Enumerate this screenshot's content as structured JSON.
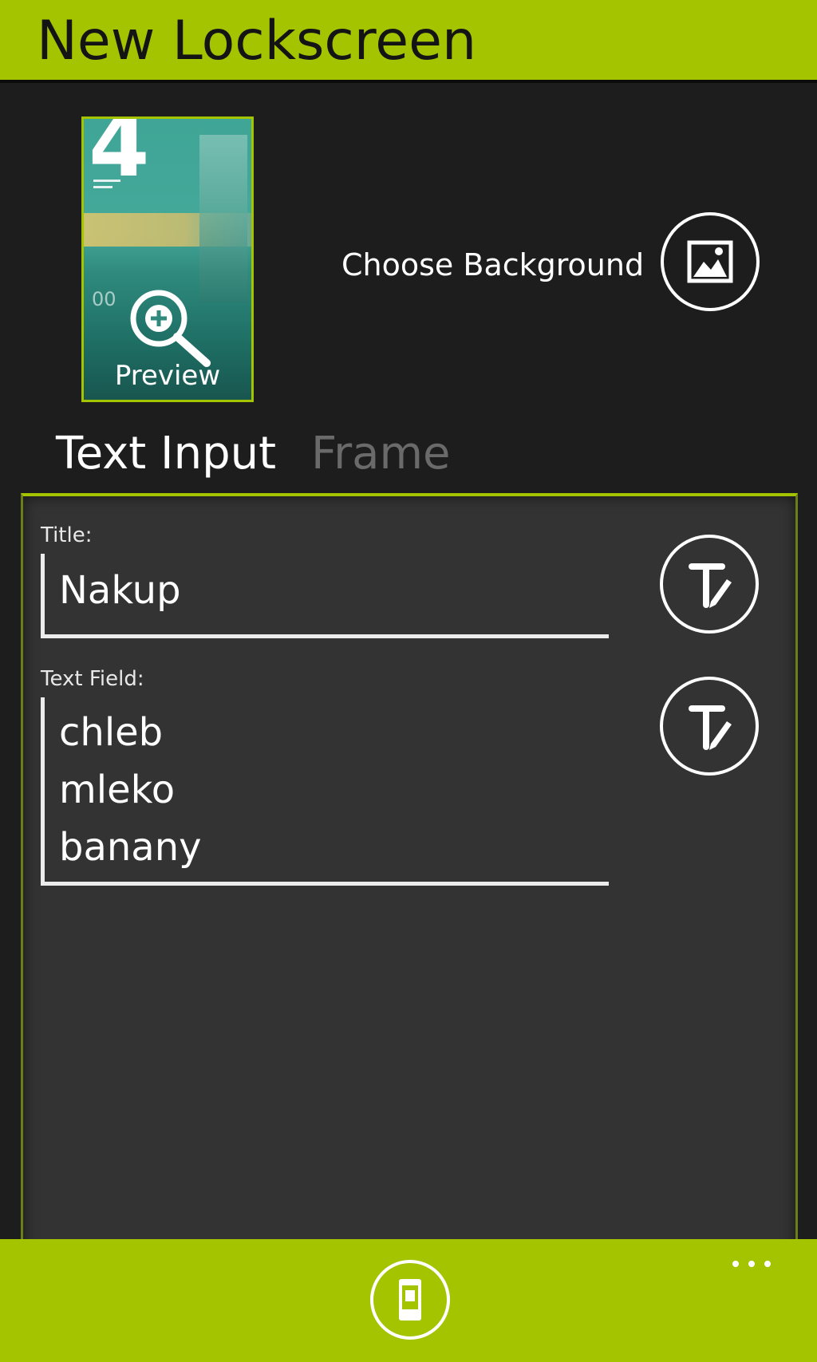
{
  "header": {
    "title": "New Lockscreen"
  },
  "preview": {
    "label": "Preview",
    "date_number": "4",
    "time_snippet": "00"
  },
  "background": {
    "choose_label": "Choose Background",
    "icon": "picture-icon"
  },
  "tabs": [
    {
      "label": "Text Input",
      "active": true
    },
    {
      "label": "Frame",
      "active": false
    }
  ],
  "form": {
    "title_label": "Title:",
    "title_value": "Nakup",
    "text_field_label": "Text Field:",
    "text_field_lines": [
      "chleb",
      "mleko",
      "banany"
    ],
    "edit_icon": "text-edit-icon"
  },
  "app_bar": {
    "button_icon": "phone-icon",
    "more_icon": "more-dots-icon"
  },
  "colors": {
    "accent": "#a4c400",
    "background": "#1d1d1d",
    "panel": "#333333",
    "inactive_tab": "#6a6a6a"
  }
}
